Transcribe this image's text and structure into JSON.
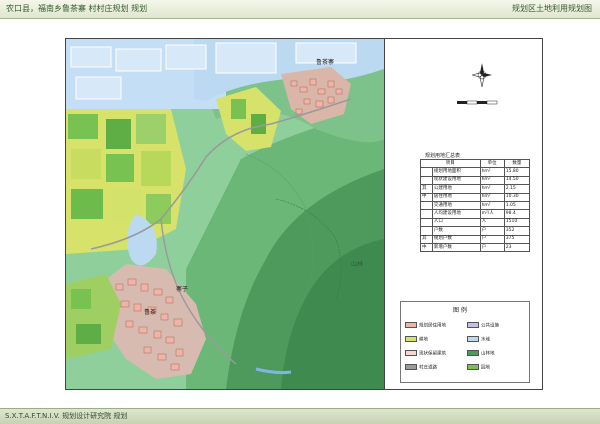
{
  "header": {
    "left_title": "农口县，福南乡鲁茶寨 村村庄规划 规划",
    "right_title": "规划区土地利用规划图"
  },
  "footer": {
    "text": "S.X.T.A.F.T.N.I.V. 规划设计研究院 规划"
  },
  "map": {
    "labels": {
      "village_ne": "鲁茶寨",
      "village_sw": "鲁茶",
      "village_s": "寨子",
      "mountain": "山林"
    },
    "colors": {
      "water": "#bcd9f2",
      "field_green": "#78c252",
      "field_yellow": "#d6e26a",
      "forest_dark": "#4e9a5c",
      "forest_light": "#a9d7b2",
      "building": "#f2b3a6"
    }
  },
  "stats": {
    "title": "规划用地汇总表",
    "header": [
      "项目",
      "单位",
      "数量"
    ],
    "rows": [
      [
        "",
        "规划用地面积",
        "hm²",
        "15.80"
      ],
      [
        "",
        "现状建设用地",
        "hm²",
        "14.50"
      ],
      [
        "其",
        "公建用地",
        "hm²",
        "2.15"
      ],
      [
        "中",
        "居住用地",
        "hm²",
        "10.30"
      ],
      [
        "",
        "交通用地",
        "hm²",
        "1.05"
      ],
      [
        "",
        "人均建设用地",
        "m²/人",
        "98.4"
      ],
      [
        "",
        "人口",
        "人",
        "1510"
      ],
      [
        "",
        "户数",
        "户",
        "352"
      ],
      [
        "其",
        "规划户数",
        "户",
        "375"
      ],
      [
        "中",
        "新增户数",
        "户",
        "23"
      ]
    ]
  },
  "legend": {
    "title": "图 例",
    "items": [
      {
        "label": "规划居住用地",
        "color": "#f2b3a6"
      },
      {
        "label": "公共设施",
        "color": "#c7bde8"
      },
      {
        "label": "耕地",
        "color": "#d6e26a"
      },
      {
        "label": "水域",
        "color": "#bcd9f2"
      },
      {
        "label": "现状保留建筑",
        "color": "#f6d7cf"
      },
      {
        "label": "山林地",
        "color": "#4e9a5c"
      },
      {
        "label": "村庄道路",
        "color": "#9a9a9a"
      },
      {
        "label": "园地",
        "color": "#78c252"
      }
    ]
  }
}
